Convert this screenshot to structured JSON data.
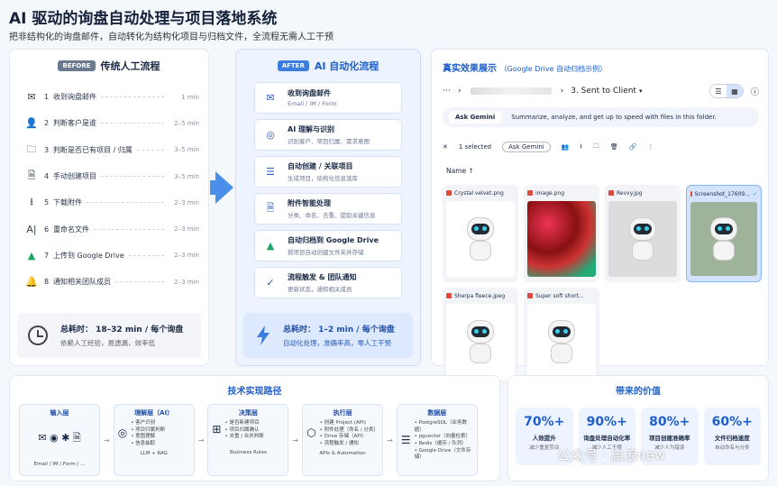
{
  "header": {
    "title": "AI 驱动的询盘自动处理与项目落地系统",
    "subtitle": "把非结构化的询盘邮件，自动转化为结构化项目与归档文件，全流程无需人工干预"
  },
  "before": {
    "tag": "BEFORE",
    "title": "传统人工流程",
    "steps": [
      {
        "n": "1",
        "label": "收到询盘邮件",
        "time": "1 min"
      },
      {
        "n": "2",
        "label": "判断客户是谁",
        "time": "2–5 min"
      },
      {
        "n": "3",
        "label": "判断是否已有项目 / 归属",
        "time": "3–5 min"
      },
      {
        "n": "4",
        "label": "手动创建项目",
        "time": "3–5 min"
      },
      {
        "n": "5",
        "label": "下载附件",
        "time": "2–3 min"
      },
      {
        "n": "6",
        "label": "重命名文件",
        "time": "2–3 min"
      },
      {
        "n": "7",
        "label": "上传到 Google Drive",
        "time": "2–3 min"
      },
      {
        "n": "8",
        "label": "通知相关团队成员",
        "time": "2–3 min"
      }
    ],
    "summary": {
      "title": "总耗时：  18–32 min / 每个询盘",
      "note": "依赖人工经验，易遗漏，效率低"
    }
  },
  "after": {
    "tag": "AFTER",
    "title": "AI 自动化流程",
    "steps": [
      {
        "title": "收到询盘邮件",
        "sub": "Email / IM / Form"
      },
      {
        "title": "AI 理解与识别",
        "sub": "识别客户、项目归属、需求意图"
      },
      {
        "title": "自动创建 / 关联项目",
        "sub": "生成项目，结构化信息落库"
      },
      {
        "title": "附件智能处理",
        "sub": "分类、命名、去重、提取关键信息"
      },
      {
        "title": "自动归档到 Google Drive",
        "sub": "按项目自动创建文件夹并存储"
      },
      {
        "title": "流程触发 & 团队通知",
        "sub": "更新状态，通知相关成员"
      }
    ],
    "summary": {
      "title": "总耗时：  1–2 min / 每个询盘",
      "note": "自动化处理，准确率高，零人工干预"
    }
  },
  "demo": {
    "title": "真实效果展示",
    "title_note": "（Google Drive 自动归档示例）",
    "breadcrumb_folder": "3. Sent to Client",
    "gemini_button": "Ask Gemini",
    "gemini_hint": "Summarize, analyze, and get up to speed with files in this folder.",
    "selected": "1 selected",
    "ask_gemini_small": "Ask Gemini",
    "name_col": "Name",
    "files": [
      {
        "name": "Crystal velvet.png",
        "kind": "robot"
      },
      {
        "name": "image.png",
        "kind": "photo"
      },
      {
        "name": "Revvy.jpg",
        "kind": "robot"
      },
      {
        "name": "Screenshot_17609...",
        "kind": "robot-green",
        "selected": true
      },
      {
        "name": "Sherpa fleece.jpeg",
        "kind": "robot"
      },
      {
        "name": "Super soft short...",
        "kind": "robot"
      }
    ]
  },
  "tech": {
    "title": "技术实现路径",
    "layers": [
      {
        "title": "输入层",
        "items": [],
        "foot": "Email / IM / Form / ..."
      },
      {
        "title": "理解层（AI）",
        "items": [
          "• 客户识别",
          "• 项目归属判断",
          "• 意图理解",
          "• 信息抽取"
        ],
        "foot": "LLM + RAG"
      },
      {
        "title": "决策层",
        "items": [
          "• 是否新建项目",
          "• 项目归属确认",
          "• 去重 / 合并判断"
        ],
        "foot": "Business Rules"
      },
      {
        "title": "执行层",
        "items": [
          "• 创建 Project (API)",
          "• 附件处理（命名 / 分类）",
          "• Drive 存储（API）",
          "• 流程触发 / 通知"
        ],
        "foot": "APIs & Automation"
      },
      {
        "title": "数据层",
        "items": [
          "• PostgreSQL（业务数据）",
          "• pgvector（向量检索）",
          "• Redis（缓存 / 队列）",
          "• Google Drive（文件存储）"
        ],
        "foot": ""
      }
    ]
  },
  "value": {
    "title": "带来的价值",
    "items": [
      {
        "num": "70%+",
        "label": "人效提升",
        "note": "减少重复劳动"
      },
      {
        "num": "90%+",
        "label": "询盘处理自动化率",
        "note": "减少人工干预"
      },
      {
        "num": "80%+",
        "label": "项目创建准确率",
        "note": "减少人为错误"
      },
      {
        "num": "60%+",
        "label": "文件归档速度",
        "note": "自动命名与分类"
      }
    ]
  },
  "watermark": "公众号 · 启浪new",
  "colors": {
    "accent": "#1f5fc9",
    "arrow": "#4a90e8",
    "after_bg": "#eef4ff"
  }
}
